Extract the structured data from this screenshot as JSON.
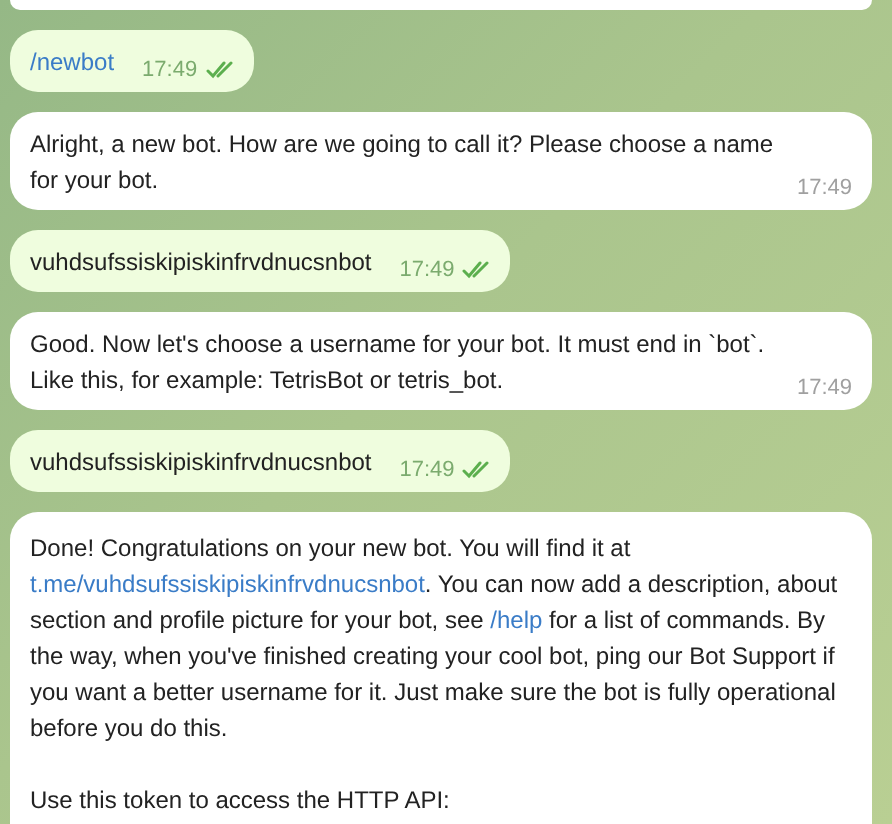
{
  "messages": [
    {
      "kind": "incoming",
      "clipped": true
    },
    {
      "kind": "outgoing",
      "paragraphs": [
        [
          {
            "kind": "link",
            "text": "/newbot"
          }
        ]
      ],
      "time": "17:49",
      "read": true
    },
    {
      "kind": "incoming",
      "paragraphs": [
        [
          {
            "kind": "text",
            "text": "Alright, a new bot. How are we going to call it? Please choose a name for your bot."
          }
        ]
      ],
      "time": "17:49"
    },
    {
      "kind": "outgoing",
      "paragraphs": [
        [
          {
            "kind": "text",
            "text": "vuhdsufssiskipiskinfrvdnucsnbot"
          }
        ]
      ],
      "time": "17:49",
      "read": true
    },
    {
      "kind": "incoming",
      "paragraphs": [
        [
          {
            "kind": "text",
            "text": "Good. Now let's choose a username for your bot. It must end in `bot`. Like this, for example: TetrisBot or tetris_bot."
          }
        ]
      ],
      "time": "17:49"
    },
    {
      "kind": "outgoing",
      "paragraphs": [
        [
          {
            "kind": "text",
            "text": "vuhdsufssiskipiskinfrvdnucsnbot"
          }
        ]
      ],
      "time": "17:49",
      "read": true
    },
    {
      "kind": "incoming",
      "clipped": true,
      "paragraphs": [
        [
          {
            "kind": "text",
            "text": "Done! Congratulations on your new bot. You will find it at "
          },
          {
            "kind": "link",
            "text": "t.me/vuhdsufssiskipiskinfrvdnucsnbot"
          },
          {
            "kind": "text",
            "text": ". You can now add a description, about section and profile picture for your bot, see "
          },
          {
            "kind": "link",
            "text": "/help"
          },
          {
            "kind": "text",
            "text": " for a list of commands. By the way, when you've finished creating your cool bot, ping our Bot Support if you want a better username for it. Just make sure the bot is fully operational before you do this."
          }
        ],
        [
          {
            "kind": "text",
            "text": "Use this token to access the HTTP API:"
          }
        ]
      ]
    }
  ]
}
